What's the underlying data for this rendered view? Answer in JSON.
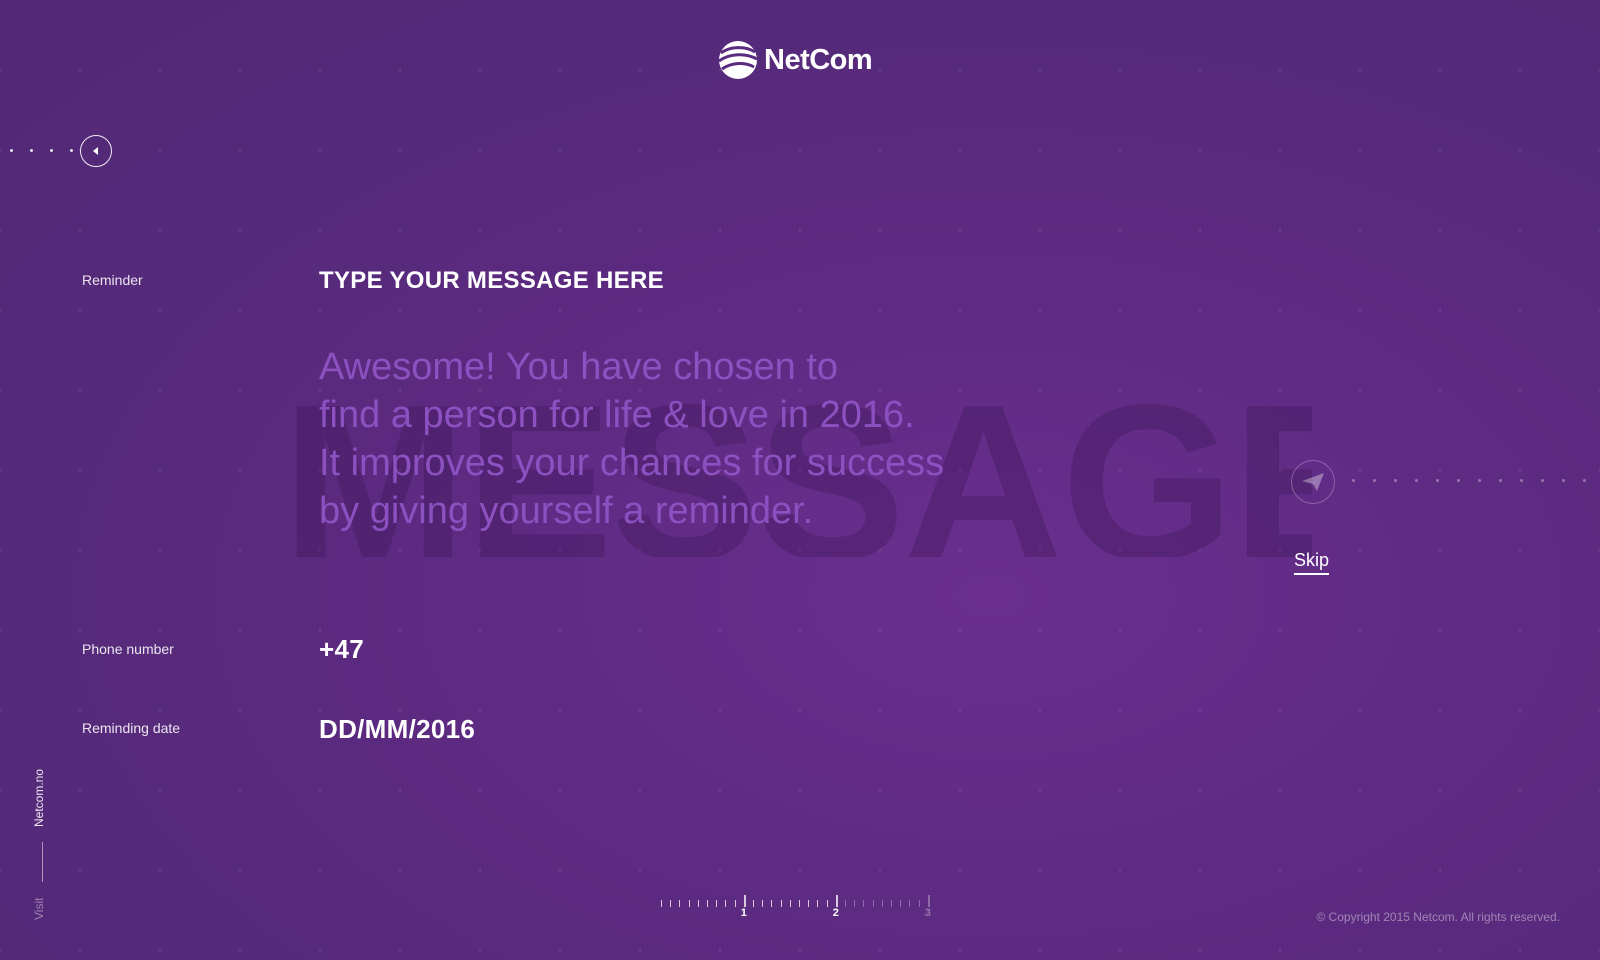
{
  "header": {
    "logo_text": "NetCom"
  },
  "watermark_text": "MESSAGE",
  "form": {
    "reminder_label": "Reminder",
    "message_heading": "TYPE YOUR MESSAGE HERE",
    "message_lines": [
      "Awesome! You have chosen to",
      "find a person for life & love in 2016.",
      "It improves your chances for success",
      "by giving yourself a reminder."
    ],
    "phone_label": "Phone number",
    "phone_value": "+47",
    "date_label": "Reminding date",
    "date_value": "DD/MM/2016"
  },
  "actions": {
    "skip_label": "Skip"
  },
  "side": {
    "site_link": "Netcom.no",
    "visit_label": "Visit"
  },
  "progress": {
    "steps": [
      "1",
      "2",
      "3"
    ],
    "current_step": 2
  },
  "footer": {
    "copyright": "© Copyright 2015 Netcom. All rights reserved."
  },
  "colors": {
    "background": "#5a2a7e",
    "message_text": "#8c51c0",
    "foreground": "#ffffff"
  }
}
